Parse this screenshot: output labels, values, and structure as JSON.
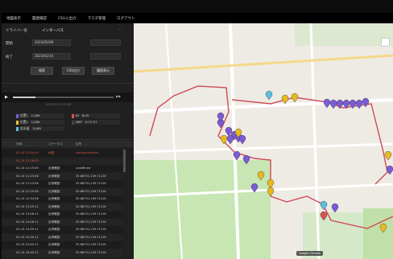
{
  "menubar": {
    "items": [
      "地図表示",
      "履歴確認",
      "CSV入出力",
      "マスタ管理",
      "ログアウト"
    ]
  },
  "panel": {
    "driver_label": "ドライバー名",
    "driver_value": "インターバス",
    "start_label": "開始",
    "start_value": "2023/02/08",
    "end_label": "終了",
    "end_value": "2023/02/14",
    "search_button": "検索",
    "csv_button": "CSV出力",
    "history_button": "履歴表示",
    "player_label": "2023.02.14 12:03",
    "legend": [
      {
        "label": "位置1",
        "value": "11/65",
        "color": "#7b5bd6"
      },
      {
        "label": "ID",
        "value": "8:03",
        "color": "#d9534f"
      },
      {
        "label": "位置1",
        "value": "11/65",
        "color": "#e8c33a"
      },
      {
        "label": "DIFF",
        "value": "0:17:27",
        "color": "#444"
      },
      {
        "label": "右半面",
        "value": "11/65",
        "color": "#5bc0de"
      }
    ],
    "table_headers": [
      "日時",
      "ステータス",
      "住所"
    ],
    "table_rows": [
      {
        "date": "02-14 12:34:03",
        "status": "休憩",
        "addr": "red placeholder",
        "red": true
      },
      {
        "date": "02-14 12:28:03",
        "status": "",
        "addr": "",
        "red": true
      },
      {
        "date": "02-14 12:15:09",
        "status": "出発確認",
        "addr": "undefined",
        "red": false
      },
      {
        "date": "02-14 11:23:56",
        "status": "出停確認",
        "addr": "35.68751,139.71216",
        "red": false
      },
      {
        "date": "02-14 11:13:56",
        "status": "出停確認",
        "addr": "35.68751,139.71216",
        "red": false
      },
      {
        "date": "02-14 12:29:56",
        "status": "出停確認",
        "addr": "35.68751,139.71216",
        "red": false
      },
      {
        "date": "02-14 12:34:56",
        "status": "出停確認",
        "addr": "35.68751,139.71216",
        "red": false
      },
      {
        "date": "02-14 13:29:11",
        "status": "出停確認",
        "addr": "35.68751,139.71216",
        "red": false
      },
      {
        "date": "02-14 13:28:11",
        "status": "出停確認",
        "addr": "35.68751,139.71216",
        "red": false
      },
      {
        "date": "02-14 14:28:11",
        "status": "出停確認",
        "addr": "35.68751,139.71216",
        "red": false
      },
      {
        "date": "02-14 14:39:11",
        "status": "出停確認",
        "addr": "35.68751,139.71216",
        "red": false
      },
      {
        "date": "02-14 15:39:11",
        "status": "出停確認",
        "addr": "35.68751,139.71216",
        "red": false
      },
      {
        "date": "02-14 15:40:11",
        "status": "出停確認",
        "addr": "35.68751,139.71216",
        "red": false
      },
      {
        "date": "02-14 16:40:11",
        "status": "出停確認",
        "addr": "35.68751,139.71216",
        "red": false
      }
    ]
  },
  "map": {
    "badge": "Google Chrome",
    "colors": {
      "route": "#d04a5a",
      "pin_purple": "#7b5bd6",
      "pin_yellow": "#e8b921",
      "pin_cyan": "#5bc0de",
      "pin_red": "#d9534f",
      "park": "#c8e6b4",
      "road": "#ffffff"
    }
  }
}
